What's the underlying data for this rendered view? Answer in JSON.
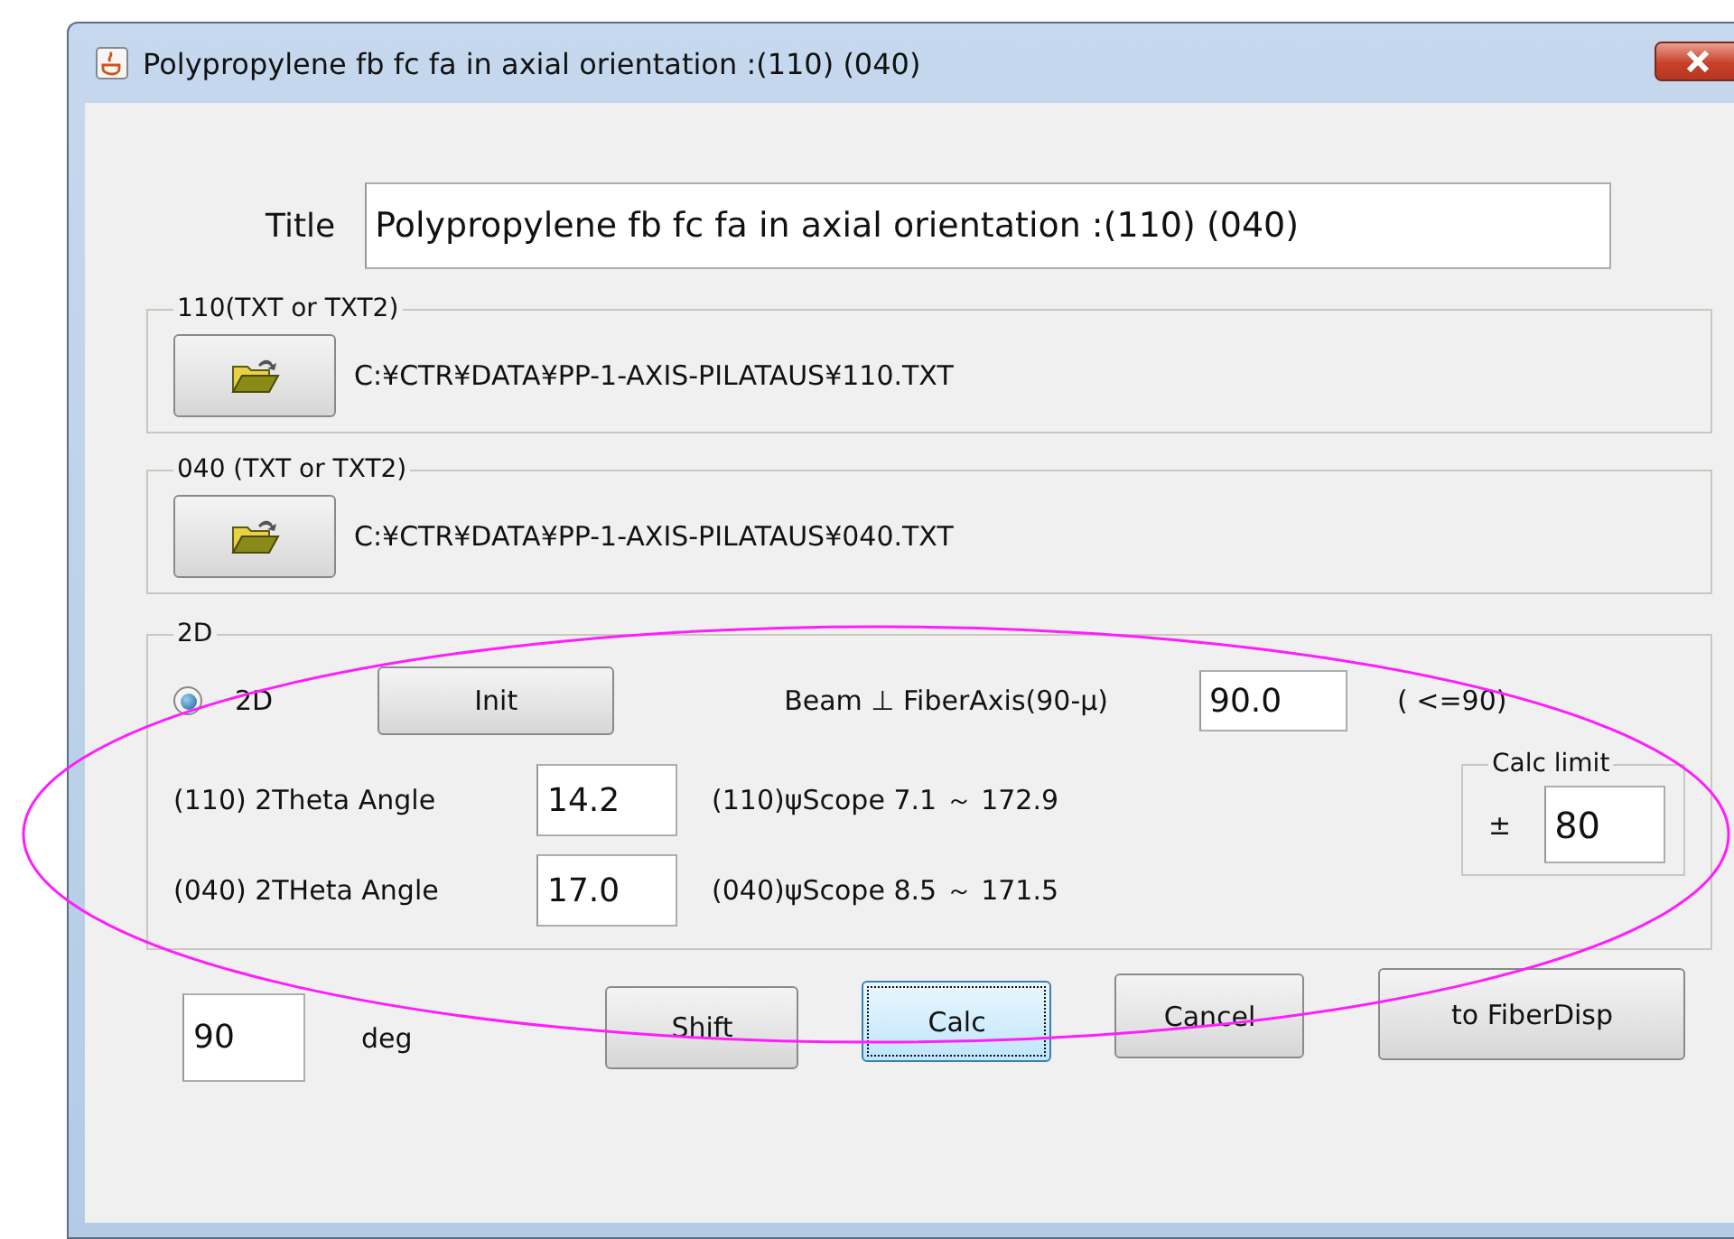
{
  "window": {
    "title": "Polypropylene fb fc fa in axial orientation :(110) (040)"
  },
  "title_field": {
    "label": "Title",
    "value": "Polypropylene fb fc fa in axial orientation :(110) (040)"
  },
  "file_groups": [
    {
      "legend": "110(TXT or TXT2)",
      "path": "C:¥CTR¥DATA¥PP-1-AXIS-PILATAUS¥110.TXT"
    },
    {
      "legend": "040 (TXT or TXT2)",
      "path": "C:¥CTR¥DATA¥PP-1-AXIS-PILATAUS¥040.TXT"
    }
  ],
  "group_2d": {
    "legend": "2D",
    "radio": {
      "label": "2D",
      "selected": true
    },
    "init_button": "Init",
    "beam_label": "Beam ⊥ FiberAxis(90-μ)",
    "beam_value": "90.0",
    "beam_hint": "( <=90)",
    "angles": [
      {
        "label": "(110) 2Theta Angle",
        "value": "14.2",
        "scope": "(110)ψScope 7.1 ～ 172.9"
      },
      {
        "label": "(040) 2THeta Angle",
        "value": "17.0",
        "scope": "(040)ψScope 8.5 ～ 171.5"
      }
    ],
    "calc_limit": {
      "legend": "Calc limit",
      "sign": "±",
      "value": "80"
    }
  },
  "footer": {
    "value": "90",
    "unit": "deg",
    "buttons": [
      {
        "label": "Shift",
        "focused": false
      },
      {
        "label": "Calc",
        "focused": true
      },
      {
        "label": "Cancel",
        "focused": false
      },
      {
        "label": "to FiberDisp",
        "focused": false
      }
    ]
  }
}
